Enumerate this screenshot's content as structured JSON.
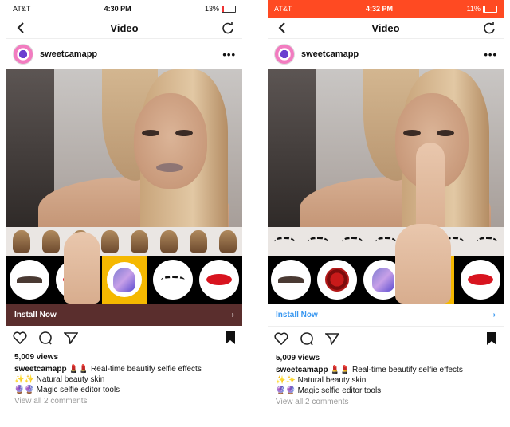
{
  "screens": [
    {
      "status": {
        "carrier": "AT&T",
        "time": "4:30 PM",
        "battery": "13%",
        "battery_level": 0.13
      },
      "nav": {
        "title": "Video"
      },
      "account": {
        "name": "sweetcamapp"
      },
      "tools": [
        "eyebrow",
        "lips",
        "wig",
        "eyelashes",
        "lips"
      ],
      "install": {
        "label": "Install Now"
      },
      "views": "5,009 views",
      "caption": {
        "user": "sweetcamapp",
        "text": "💄💄 Real-time beautify selfie effects",
        "line2": "✨✨ Natural beauty skin",
        "line3": "🔮🔮 Magic selfie editor tools"
      },
      "comments": "View all 2 comments"
    },
    {
      "status": {
        "carrier": "AT&T",
        "time": "4:32 PM",
        "battery": "11%",
        "battery_level": 0.11
      },
      "nav": {
        "title": "Video"
      },
      "account": {
        "name": "sweetcamapp"
      },
      "tools": [
        "eyebrow",
        "rose",
        "wig",
        "eyelashes",
        "lips"
      ],
      "install": {
        "label": "Install Now"
      },
      "views": "5,009 views",
      "caption": {
        "user": "sweetcamapp",
        "text": "💄💄 Real-time beautify selfie effects",
        "line2": "✨✨ Natural beauty skin",
        "line3": "🔮🔮 Magic selfie editor tools"
      },
      "comments": "View all 2 comments"
    }
  ],
  "colors": {
    "accent_red": "#ff4a22",
    "install_bg": "#5a2e2d",
    "install_link": "#3897f0",
    "tool_selected": "#f5b800"
  }
}
